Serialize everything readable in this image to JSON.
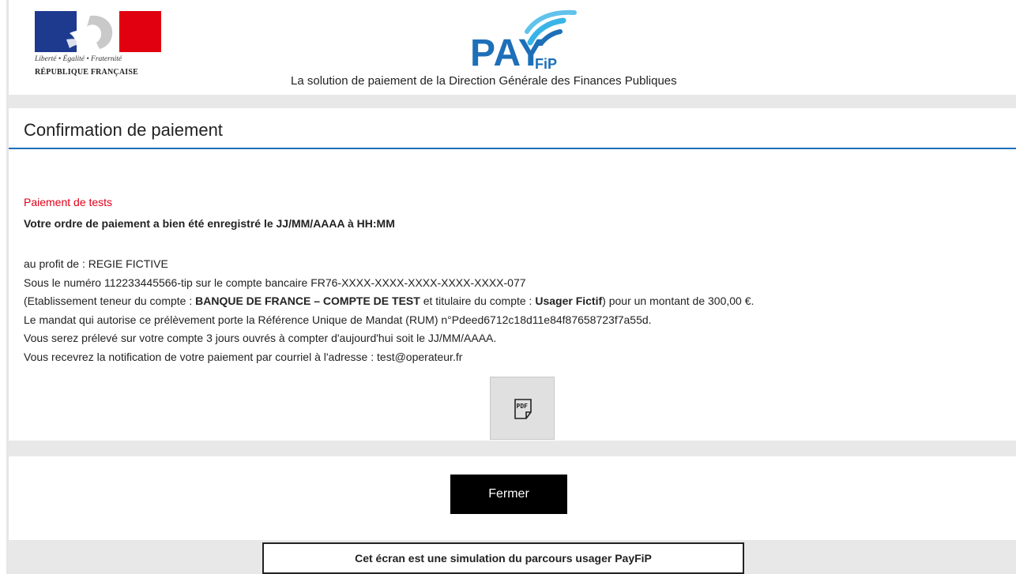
{
  "header": {
    "motto": "Liberté • Égalité • Fraternité",
    "republic": "RÉPUBLIQUE FRANÇAISE",
    "logo_pay": "PAY",
    "logo_fip": "FiP",
    "tagline": "La solution de paiement de la Direction Générale des Finances Publiques"
  },
  "page": {
    "title": "Confirmation de paiement"
  },
  "payment": {
    "status": "Paiement de tests",
    "confirmation": "Votre ordre de paiement a bien été enregistré le JJ/MM/AAAA à HH:MM",
    "beneficiary": "au profit de : REGIE FICTIVE",
    "account_line": "Sous le numéro 112233445566-tip sur le compte bancaire FR76-XXXX-XXXX-XXXX-XXXX-XXXX-077",
    "bank_prefix": "(Etablissement teneur du compte : ",
    "bank_name": "BANQUE DE FRANCE – COMPTE DE TEST",
    "holder_prefix": " et titulaire du compte : ",
    "holder_name": "Usager Fictif",
    "amount_suffix": ") pour un montant de 300,00 €.",
    "mandate": "Le mandat qui autorise ce prélèvement porte la Référence Unique de Mandat (RUM) n°Pdeed6712c18d11e84f87658723f7a55d.",
    "debit_date": "Vous serez prélevé sur votre compte 3 jours ouvrés à compter d'aujourd'hui soit le JJ/MM/AAAA.",
    "notification": "Vous recevrez la notification de votre paiement par courriel à l'adresse : test@operateur.fr"
  },
  "actions": {
    "pdf_icon": "pdf-download-icon",
    "close_label": "Fermer"
  },
  "footer": {
    "notice": "Cet écran est une simulation du parcours usager PayFiP"
  },
  "colors": {
    "accent_blue": "#1d6fb8",
    "alert_red": "#e2001a",
    "band_gray": "#e8e8e8",
    "button_black": "#000000"
  }
}
